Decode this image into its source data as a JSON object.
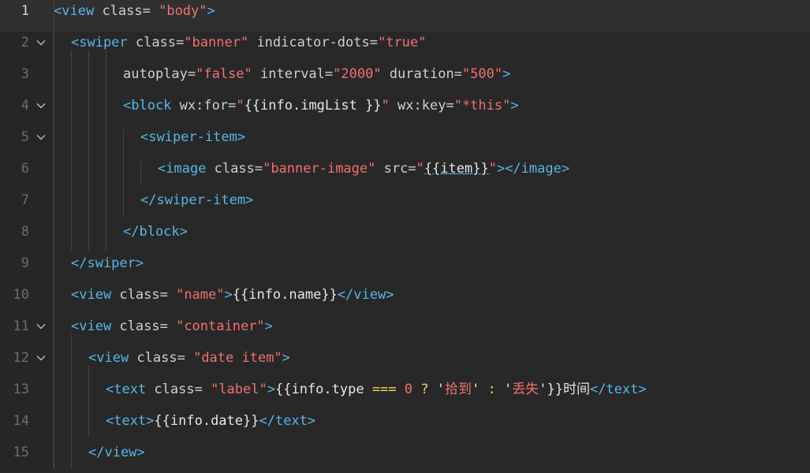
{
  "editor": {
    "lines": [
      {
        "num": "1",
        "tokens": [
          {
            "t": "<",
            "c": "tag"
          },
          {
            "t": "view",
            "c": "tag"
          },
          {
            "t": " class= ",
            "c": "attr"
          },
          {
            "t": "\"body\"",
            "c": "str"
          },
          {
            "t": ">",
            "c": "tag"
          }
        ]
      },
      {
        "num": "2",
        "tokens": [
          {
            "t": "<swiper",
            "c": "tag"
          },
          {
            "t": " class=",
            "c": "attr"
          },
          {
            "t": "\"banner\"",
            "c": "str"
          },
          {
            "t": " indicator-dots=",
            "c": "attr"
          },
          {
            "t": "\"true\"",
            "c": "str"
          }
        ]
      },
      {
        "num": "3",
        "tokens": [
          {
            "t": "autoplay=",
            "c": "attr"
          },
          {
            "t": "\"false\"",
            "c": "str"
          },
          {
            "t": " interval=",
            "c": "attr"
          },
          {
            "t": "\"2000\"",
            "c": "str"
          },
          {
            "t": " duration=",
            "c": "attr"
          },
          {
            "t": "\"500\"",
            "c": "str"
          },
          {
            "t": ">",
            "c": "tag"
          }
        ]
      },
      {
        "num": "4",
        "tokens": [
          {
            "t": "<block",
            "c": "tag"
          },
          {
            "t": " wx:for=",
            "c": "attr"
          },
          {
            "t": "\"",
            "c": "str"
          },
          {
            "t": "{{info.imgList }}",
            "c": "txt"
          },
          {
            "t": "\"",
            "c": "str"
          },
          {
            "t": " wx:key=",
            "c": "attr"
          },
          {
            "t": "\"*this\"",
            "c": "str"
          },
          {
            "t": ">",
            "c": "tag"
          }
        ]
      },
      {
        "num": "5",
        "tokens": [
          {
            "t": "<swiper-item>",
            "c": "tag"
          }
        ]
      },
      {
        "num": "6",
        "tokens": [
          {
            "t": "<image",
            "c": "tag"
          },
          {
            "t": " class=",
            "c": "attr"
          },
          {
            "t": "\"banner-image\"",
            "c": "str"
          },
          {
            "t": " src=",
            "c": "attr"
          },
          {
            "t": "\"",
            "c": "str"
          },
          {
            "t": "{{item}}",
            "c": "txt link"
          },
          {
            "t": "\"",
            "c": "str"
          },
          {
            "t": "></image>",
            "c": "tag"
          }
        ]
      },
      {
        "num": "7",
        "tokens": [
          {
            "t": "</swiper-item>",
            "c": "tag"
          }
        ]
      },
      {
        "num": "8",
        "tokens": [
          {
            "t": "</block>",
            "c": "tag"
          }
        ]
      },
      {
        "num": "9",
        "tokens": [
          {
            "t": "</swiper>",
            "c": "tag"
          }
        ]
      },
      {
        "num": "10",
        "tokens": [
          {
            "t": "<view",
            "c": "tag"
          },
          {
            "t": " class= ",
            "c": "attr"
          },
          {
            "t": "\"name\"",
            "c": "str"
          },
          {
            "t": ">",
            "c": "tag"
          },
          {
            "t": "{{info.name}}",
            "c": "txt"
          },
          {
            "t": "</view>",
            "c": "tag"
          }
        ]
      },
      {
        "num": "11",
        "tokens": [
          {
            "t": "<view",
            "c": "tag"
          },
          {
            "t": " class= ",
            "c": "attr"
          },
          {
            "t": "\"container\"",
            "c": "str"
          },
          {
            "t": ">",
            "c": "tag"
          }
        ]
      },
      {
        "num": "12",
        "tokens": [
          {
            "t": "<view",
            "c": "tag"
          },
          {
            "t": " class= ",
            "c": "attr"
          },
          {
            "t": "\"date item\"",
            "c": "str"
          },
          {
            "t": ">",
            "c": "tag"
          }
        ]
      },
      {
        "num": "13",
        "tokens": [
          {
            "t": "<text",
            "c": "tag"
          },
          {
            "t": " class= ",
            "c": "attr"
          },
          {
            "t": "\"label\"",
            "c": "str"
          },
          {
            "t": ">",
            "c": "tag"
          },
          {
            "t": "{{info.type ",
            "c": "txt"
          },
          {
            "t": "===",
            "c": "op"
          },
          {
            "t": " ",
            "c": "txt"
          },
          {
            "t": "0",
            "c": "num"
          },
          {
            "t": " ",
            "c": "txt"
          },
          {
            "t": "?",
            "c": "op"
          },
          {
            "t": " '",
            "c": "txt"
          },
          {
            "t": "拾到",
            "c": "str"
          },
          {
            "t": "' ",
            "c": "txt"
          },
          {
            "t": ":",
            "c": "op"
          },
          {
            "t": " '",
            "c": "txt"
          },
          {
            "t": "丢失",
            "c": "str"
          },
          {
            "t": "'}}时间",
            "c": "txt"
          },
          {
            "t": "</text>",
            "c": "tag"
          }
        ]
      },
      {
        "num": "14",
        "tokens": [
          {
            "t": "<text>",
            "c": "tag"
          },
          {
            "t": "{{info.date}}",
            "c": "txt"
          },
          {
            "t": "</text>",
            "c": "tag"
          }
        ]
      },
      {
        "num": "15",
        "tokens": [
          {
            "t": "</view>",
            "c": "tag"
          }
        ]
      }
    ]
  }
}
